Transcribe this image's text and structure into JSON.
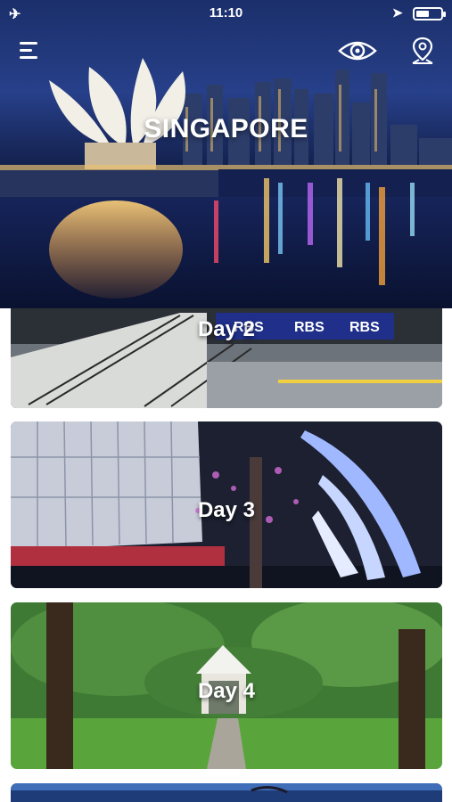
{
  "status_bar": {
    "time": "11:10",
    "airplane_icon": "✈",
    "location_icon": "➤",
    "battery_level": 0.55
  },
  "header": {
    "city": "SINGAPORE",
    "icons": [
      "menu-icon",
      "eye-icon",
      "map-pin-icon"
    ]
  },
  "days": [
    {
      "label": "Day 2",
      "image": "formula-one-track-stands"
    },
    {
      "label": "Day 3",
      "image": "christmas-lights-orchard-road"
    },
    {
      "label": "Day 4",
      "image": "botanic-gardens-gazebo"
    },
    {
      "label": "",
      "image": "city-skyline"
    }
  ],
  "banner_text": "RBS",
  "colors": {
    "hero_sky": "#22397c",
    "water": "#0b1535",
    "text": "#ffffff"
  }
}
